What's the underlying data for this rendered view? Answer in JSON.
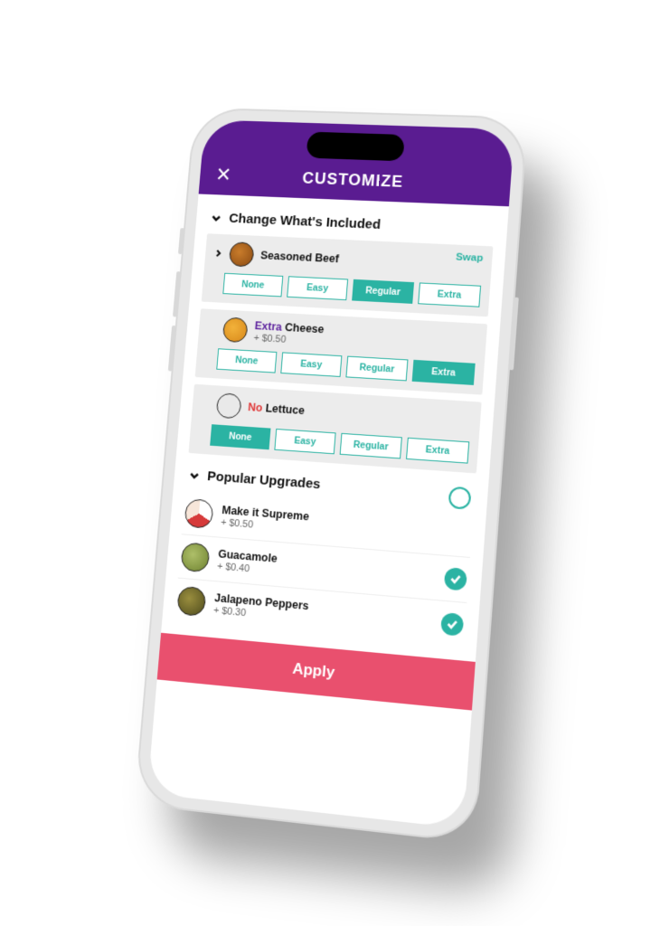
{
  "header": {
    "title": "CUSTOMIZE",
    "close": "✕",
    "swap": "Swap"
  },
  "section_included": "Change What's Included",
  "section_upgrades": "Popular Upgrades",
  "options": {
    "none": "None",
    "easy": "Easy",
    "regular": "Regular",
    "extra": "Extra"
  },
  "ingredients": [
    {
      "name": "Seasoned Beef",
      "modifier": "",
      "sub": "",
      "selected": "regular",
      "swap": true,
      "expand": true,
      "avatar": "beef"
    },
    {
      "name": "Cheese",
      "modifier": "Extra",
      "modClass": "mod-extra",
      "sub": "+ $0.50",
      "selected": "extra",
      "swap": false,
      "expand": false,
      "avatar": "cheese"
    },
    {
      "name": "Lettuce",
      "modifier": "No",
      "modClass": "mod-no",
      "sub": "",
      "selected": "none",
      "swap": false,
      "expand": false,
      "avatar": "lettuce-a"
    }
  ],
  "upgrades": [
    {
      "name": "Make it Supreme",
      "sub": "+ $0.50",
      "checked": false,
      "openCircle": true,
      "avatar": "supreme"
    },
    {
      "name": "Guacamole",
      "sub": "+ $0.40",
      "checked": true,
      "avatar": "guac"
    },
    {
      "name": "Jalapeno Peppers",
      "sub": "+ $0.30",
      "checked": true,
      "avatar": "jalapeno"
    }
  ],
  "apply": "Apply"
}
